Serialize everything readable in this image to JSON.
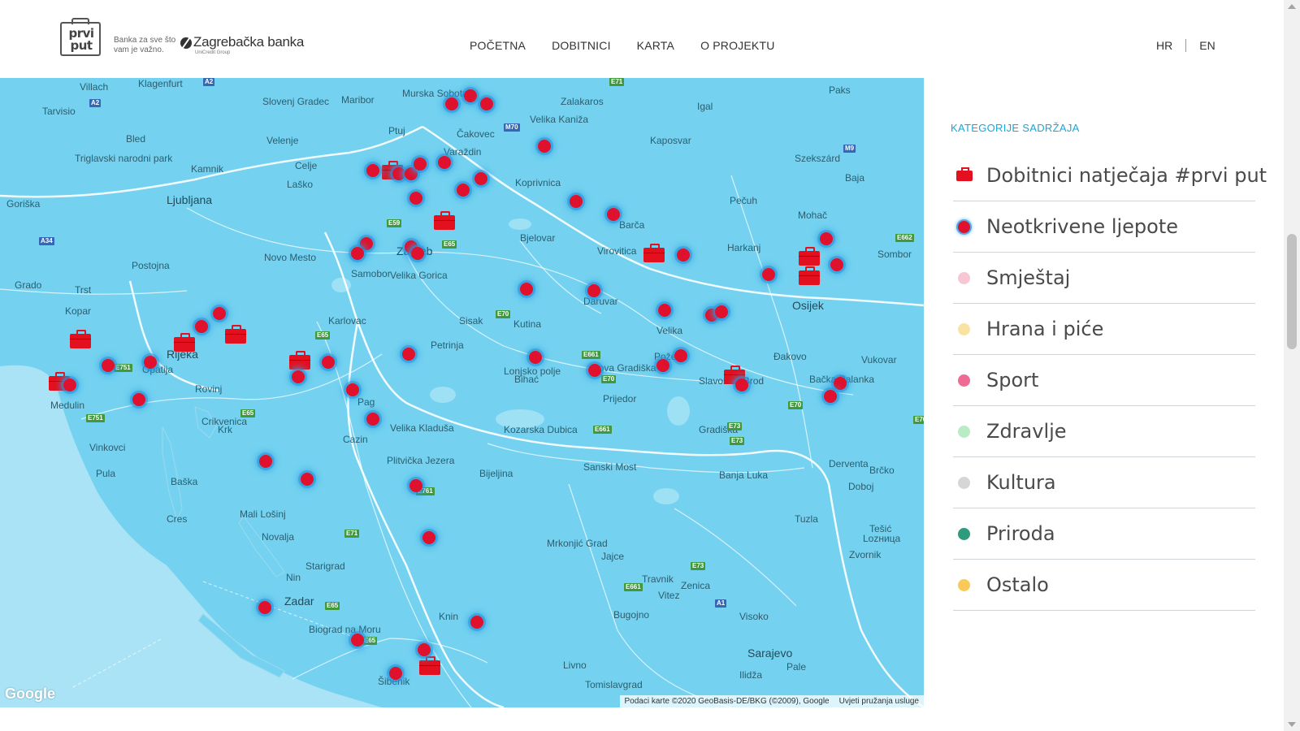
{
  "header": {
    "logo_text_line1": "prvi",
    "logo_text_line2": "put",
    "tagline": "Banka za sve što vam je važno.",
    "bank_name": "Zagrebačka banka",
    "bank_sub": "UniCredit Group",
    "nav": [
      "POČETNA",
      "DOBITNICI",
      "KARTA",
      "O PROJEKTU"
    ],
    "lang": [
      "HR",
      "EN"
    ]
  },
  "map": {
    "google_logo": "Google",
    "attribution": "Podaci karte ©2020 GeoBasis-DE/BKG (©2009), Google",
    "terms": "Uvjeti pružanja usluge",
    "water_color": "#74d2f0",
    "places": {
      "big": [
        "Ljubljana",
        "Zagreb",
        "Sarajevo",
        "Osijek",
        "Rijeka",
        "Zadar"
      ],
      "small": [
        "Villach",
        "Klagenfurt",
        "Maribor",
        "Murska Sobota",
        "Zalakaros",
        "Velika Kaniža",
        "Paks",
        "Igal",
        "Tarvisio",
        "Slovenj Gradec",
        "Ptuj",
        "Čakovec",
        "Kaposvar",
        "Szekszárd",
        "Bled",
        "Velenje",
        "Triglavski narodni park",
        "Kamnik",
        "Celje",
        "Varaždin",
        "Koprivnica",
        "Baja",
        "Pečuh",
        "Laško",
        "Mohač",
        "Goriška",
        "Bjelovar",
        "Barča",
        "Virovitica",
        "Harkanj",
        "Sombor",
        "Novo Mesto",
        "Samobor",
        "Velika Gorica",
        "Postojna",
        "Grado",
        "Trst",
        "Kopar",
        "Karlovac",
        "Sisak",
        "Kutina",
        "Daruvar",
        "Velika",
        "Petrinja",
        "Lonjsko polje",
        "Nova Gradiška",
        "Požega",
        "Slavonski Brod",
        "Đakovo",
        "Vukovar",
        "Bačka Palanka",
        "Vinkovci",
        "Pula",
        "Medulin",
        "Rovinj",
        "Crikvenica",
        "Krk",
        "Baška",
        "Cres",
        "Mali Lošinj",
        "Novalja",
        "Pag",
        "Velika Kladuša",
        "Cazin",
        "Plitvička Jezera",
        "Bihać",
        "Kozarska Dubica",
        "Prijedor",
        "Gradiška",
        "Derventa",
        "Brčko",
        "Bijeljina",
        "Sanski Most",
        "Banja Luka",
        "Doboj",
        "Tešić",
        "Tuzla",
        "Lozница",
        "Zvornik",
        "Mrkonjić Grad",
        "Jajce",
        "Travnik",
        "Zenica",
        "Vitez",
        "Bugojno",
        "Visoko",
        "Pale",
        "Ilidža",
        "Starigrad",
        "Nin",
        "Biograd na Moru",
        "Šibenik",
        "Knin",
        "Livno",
        "Tomislavgrad",
        "Opatija"
      ]
    },
    "roads": [
      "A2",
      "A2",
      "E71",
      "M70",
      "M9",
      "A34",
      "E59",
      "E65",
      "E662",
      "E70",
      "E65",
      "E751",
      "E751",
      "E661",
      "E70",
      "E70",
      "E65",
      "E71",
      "E661",
      "E73",
      "E73",
      "E761",
      "E661",
      "E73",
      "A1",
      "E65",
      "E65",
      "E70"
    ]
  },
  "sidebar": {
    "title": "KATEGORIJE SADRŽAJA",
    "categories": [
      {
        "label": "Dobitnici natječaja #prvi put",
        "color": "#e3101f",
        "icon": "briefcase-icon"
      },
      {
        "label": "Neotkrivene ljepote",
        "color": "#e0112d",
        "icon": "dot-icon"
      },
      {
        "label": "Smještaj",
        "color": "#f7c6d3",
        "icon": "dot-icon"
      },
      {
        "label": "Hrana i piće",
        "color": "#f9e3a3",
        "icon": "dot-icon"
      },
      {
        "label": "Sport",
        "color": "#ee6b94",
        "icon": "dot-icon"
      },
      {
        "label": "Zdravlje",
        "color": "#b9ebc4",
        "icon": "dot-icon"
      },
      {
        "label": "Kultura",
        "color": "#d6d6d6",
        "icon": "dot-icon"
      },
      {
        "label": "Priroda",
        "color": "#2e9b7d",
        "icon": "dot-icon"
      },
      {
        "label": "Ostalo",
        "color": "#f7ca5a",
        "icon": "dot-icon"
      }
    ]
  }
}
